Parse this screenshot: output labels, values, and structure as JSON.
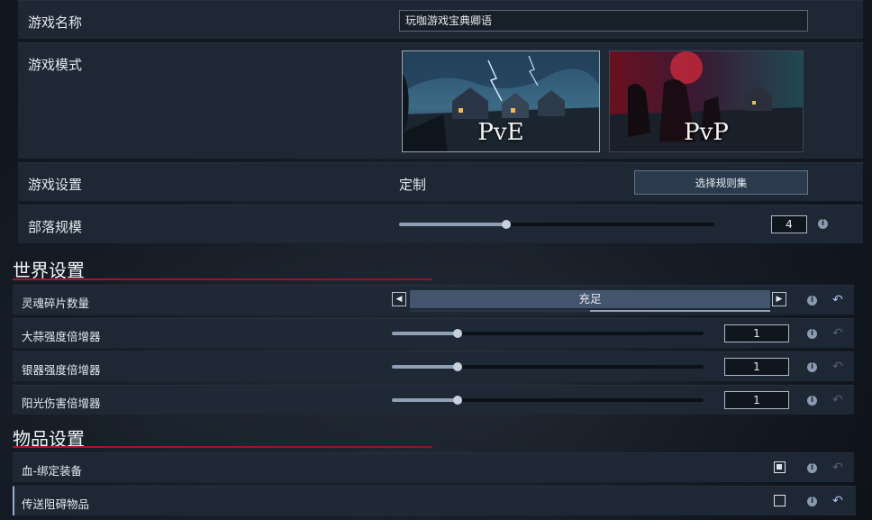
{
  "settings": {
    "game_name": {
      "label": "游戏名称",
      "value": "玩咖游戏宝典卿语"
    },
    "game_mode": {
      "label": "游戏模式",
      "options": [
        {
          "label": "PvE",
          "selected": true
        },
        {
          "label": "PvP",
          "selected": false
        }
      ]
    },
    "game_settings": {
      "label": "游戏设置",
      "value": "定制",
      "button_label": "选择规则集"
    },
    "clan_size": {
      "label": "部落规模",
      "value": "4",
      "slider_fraction": 0.34
    }
  },
  "world_settings": {
    "title": "世界设置",
    "rows": [
      {
        "label": "灵魂碎片数量",
        "type": "selector",
        "value": "充足"
      },
      {
        "label": "大蒜强度倍增器",
        "type": "slider",
        "value": "1",
        "slider_fraction": 0.21
      },
      {
        "label": "银器强度倍增器",
        "type": "slider",
        "value": "1",
        "slider_fraction": 0.21
      },
      {
        "label": "阳光伤害倍增器",
        "type": "slider",
        "value": "1",
        "slider_fraction": 0.21
      }
    ]
  },
  "item_settings": {
    "title": "物品设置",
    "rows": [
      {
        "label": "血-绑定装备",
        "checked": true
      },
      {
        "label": "传送阻碍物品",
        "checked": false
      }
    ]
  },
  "icons": {
    "info": "info-icon",
    "reset": "reset-icon",
    "left": "arrow-left-icon",
    "right": "arrow-right-icon"
  },
  "colors": {
    "accent_red": "#b0122a",
    "panel": "#1f2936",
    "reset_active": "#a9c4ee",
    "reset_inactive": "#55606e"
  }
}
